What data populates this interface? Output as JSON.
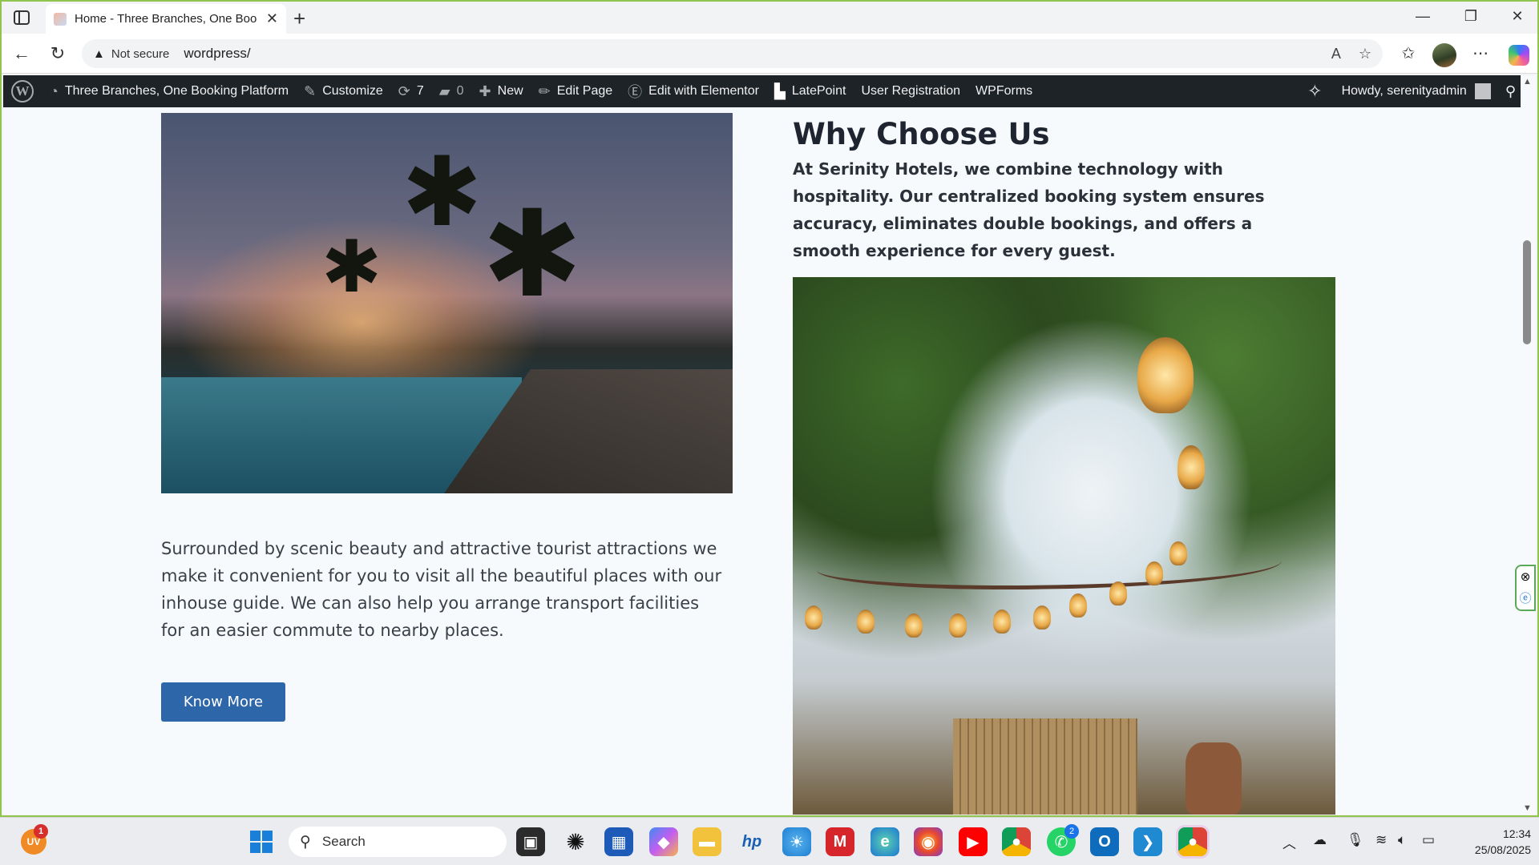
{
  "browser": {
    "tab_title": "Home - Three Branches, One Boo",
    "security_label": "Not secure",
    "url": "wordpress/"
  },
  "adminbar": {
    "site_name": "Three Branches, One Booking Platform",
    "customize": "Customize",
    "updates_count": "7",
    "comments_count": "0",
    "new": "New",
    "edit_page": "Edit Page",
    "edit_elementor": "Edit with Elementor",
    "latepoint": "LatePoint",
    "user_registration": "User Registration",
    "wpforms": "WPForms",
    "howdy": "Howdy, serenityadmin"
  },
  "content": {
    "intro_paragraph": "Surrounded by scenic beauty and attractive tourist attractions we make it convenient for you to visit all the beautiful places with our inhouse guide. We can also help you arrange transport facilities for an easier commute to nearby places.",
    "know_more_label": "Know More",
    "why_title": "Why Choose Us",
    "why_text": "At Serinity Hotels, we combine technology with hospitality. Our centralized booking system ensures accuracy, eliminates double bookings, and offers a smooth experience for every guest."
  },
  "taskbar": {
    "search_placeholder": "Search",
    "uv_label": "UV",
    "uv_badge": "1",
    "whatsapp_badge": "2",
    "time": "12:34",
    "date": "25/08/2025"
  }
}
